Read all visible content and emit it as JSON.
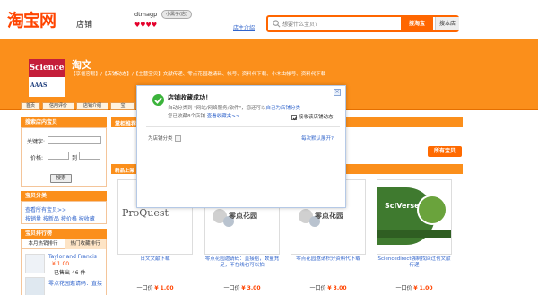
{
  "header": {
    "logo_text": "淘宝网",
    "logo_sub": "店铺",
    "user_name": "dtmagp",
    "user_badge": "小黑子(店)",
    "hearts": "♥♥♥♥",
    "shop_link": "店主介绍",
    "search_placeholder": "想要什么宝贝?",
    "search_taobao_label": "搜淘宝",
    "search_shop_label": "搜本店"
  },
  "banner": {
    "logo_top": "Science",
    "logo_bottom": "AAAS",
    "shop_title": "淘文",
    "shop_desc": "【享框容易】/【店铺动态】/【主营宝贝】文献传递、零点花园邀请码、帐号、资料代下载、小木虫帐号、资料代下载"
  },
  "nav": {
    "tabs": [
      "首页",
      "信用评价",
      "店铺介绍",
      "宝"
    ]
  },
  "sidebar": {
    "search_head": "搜索店内宝贝",
    "keyword_label": "关键字:",
    "price_label": "价格:",
    "price_sep": "到",
    "search_btn": "搜索",
    "category_head": "宝贝分类",
    "all_items_link": "查看所有宝贝>>",
    "sort_links": "按销量  按新品  按价格  按收藏",
    "rank_head": "宝贝排行榜",
    "rank_tab_sales": "本月热销排行",
    "rank_tab_fav": "热门收藏排行",
    "rank_item_title": "Taylor and Francis",
    "rank_item_price": "¥ 1.00",
    "rank_item_sold": "已售出 46 件",
    "rank_item2": "零点花园邀请码：直接"
  },
  "main": {
    "section_head": "掌柜推荐宝贝",
    "all_button": "所有宝贝",
    "new_head": "新品上架",
    "products": [
      {
        "img": "ProQuest",
        "title": "日文文献下载",
        "price_label": "一口价",
        "price": "¥ 1.00"
      },
      {
        "img": "零点花园",
        "title": "零点花园邀请码：直接给，数量充足，不在线也可以拍",
        "price_label": "一口价",
        "price": "¥ 3.00"
      },
      {
        "img": "零点花园",
        "title": "零点花园邀请积分资料代下载",
        "price_label": "一口价",
        "price": "¥ 3.00"
      },
      {
        "img": "SciVerse",
        "title": "Sciencedirect强制找回过刊文献传递",
        "price_label": "一口价",
        "price": "¥ 1.00"
      }
    ]
  },
  "popup": {
    "title": "店铺收藏成功！",
    "line1_prefix": "自动分类到 \"网站/网络服务/软件\"，您还可以",
    "line1_link": "自己为店铺分类",
    "line2_prefix": "您已收藏",
    "line2_count": "8",
    "line2_suffix": "个店铺",
    "line2_link": "查看收藏夹>>",
    "checkbox_label": "接收该店铺动态",
    "select_label": "为店铺分类",
    "expand_link": "每次默认展开?"
  },
  "colors": {
    "brand_orange": "#fb8f1b",
    "accent": "#ff4400",
    "link": "#3366cc"
  }
}
